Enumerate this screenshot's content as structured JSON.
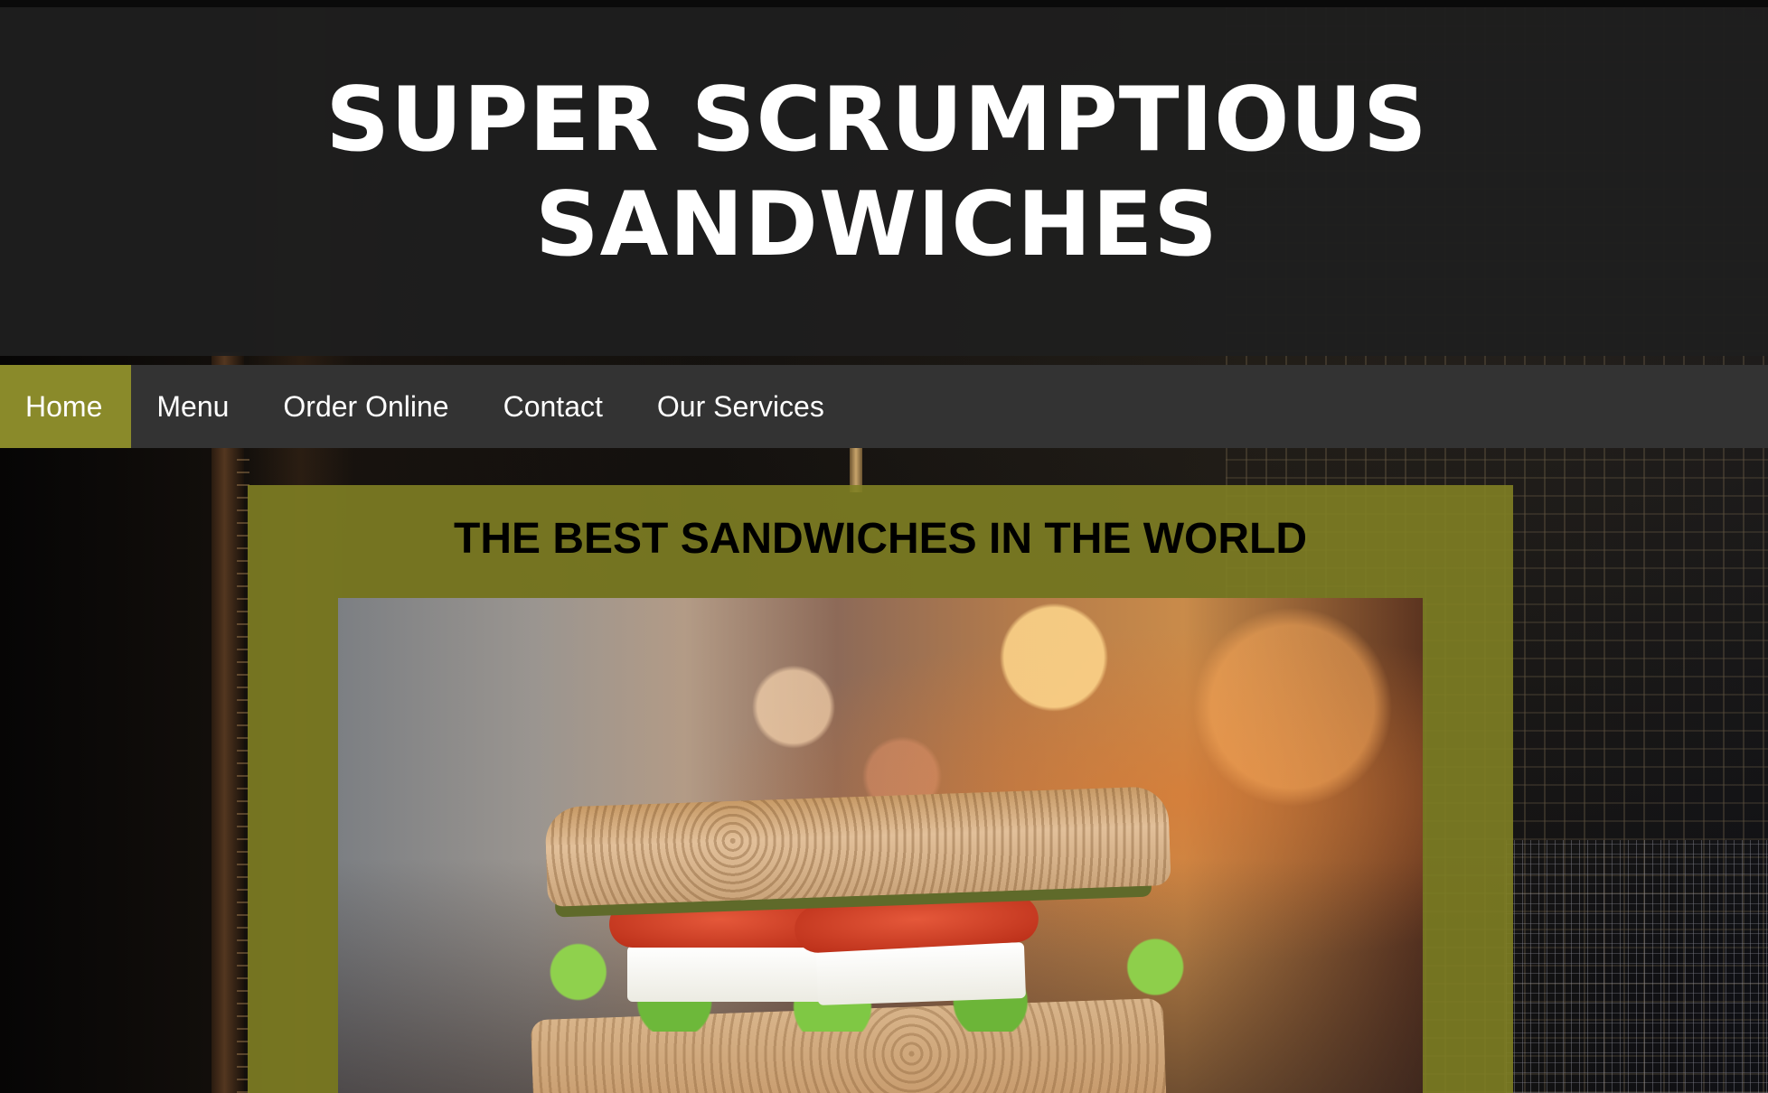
{
  "site": {
    "title": "SUPER SCRUMPTIOUS SANDWICHES"
  },
  "nav": {
    "items": [
      {
        "label": "Home",
        "active": true
      },
      {
        "label": "Menu",
        "active": false
      },
      {
        "label": "Order Online",
        "active": false
      },
      {
        "label": "Contact",
        "active": false
      },
      {
        "label": "Our Services",
        "active": false
      }
    ]
  },
  "main": {
    "heading": "THE BEST SANDWICHES IN THE WORLD",
    "hero_image": "sandwich-photo"
  },
  "colors": {
    "header_bg": "#1e1e1e",
    "nav_bg": "#333333",
    "nav_active": "#8a8a2a",
    "panel_bg": "#808024",
    "title_text": "#ffffff",
    "heading_text": "#000000"
  }
}
